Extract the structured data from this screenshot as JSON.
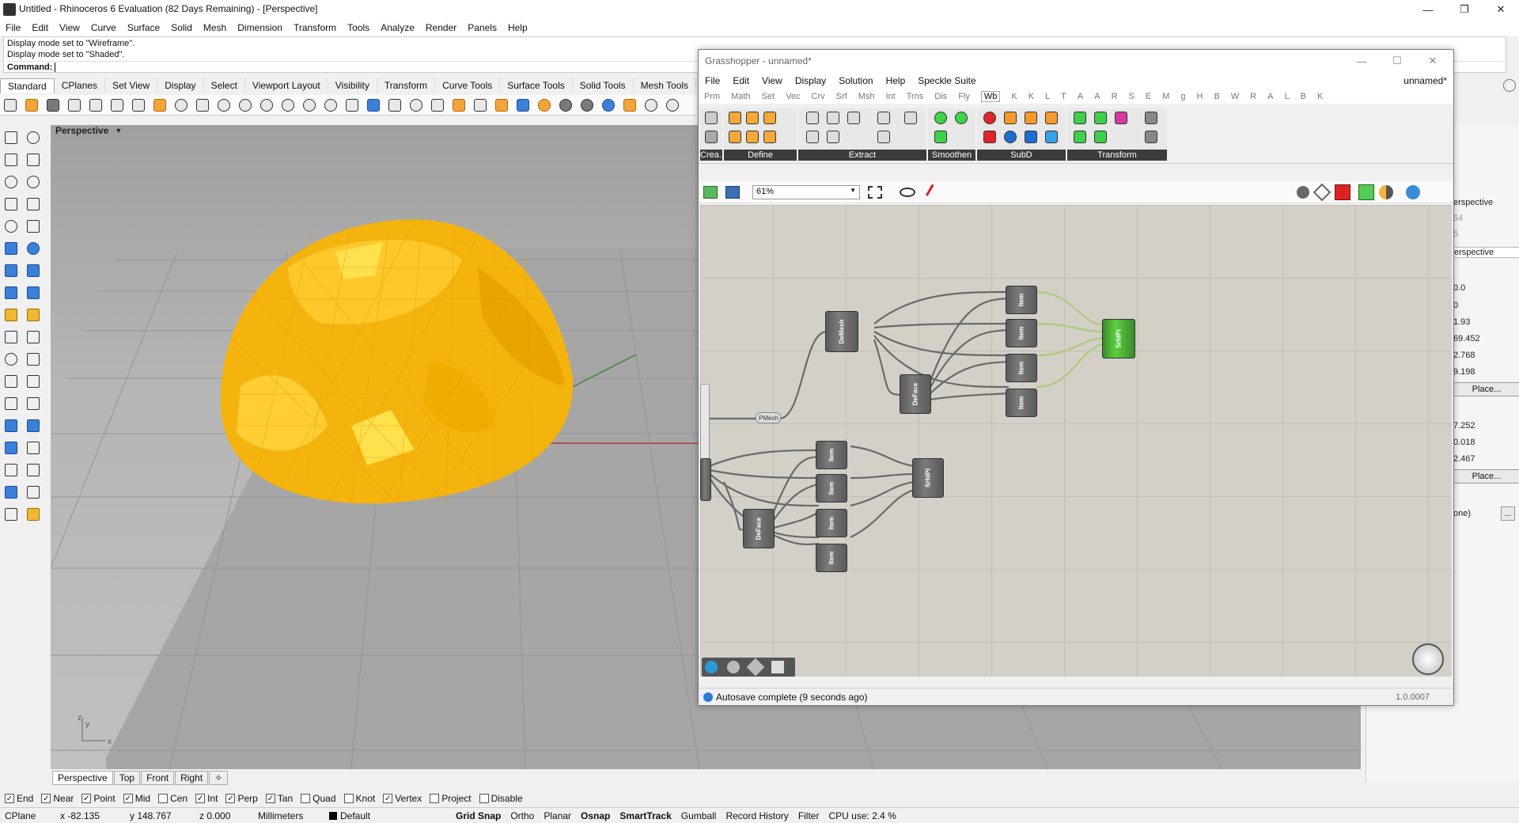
{
  "app": {
    "title": "Untitled - Rhinoceros 6 Evaluation (82 Days Remaining) - [Perspective]"
  },
  "menu": [
    "File",
    "Edit",
    "View",
    "Curve",
    "Surface",
    "Solid",
    "Mesh",
    "Dimension",
    "Transform",
    "Tools",
    "Analyze",
    "Render",
    "Panels",
    "Help"
  ],
  "command": {
    "history": [
      "Display mode set to \"Wireframe\".",
      "Display mode set to \"Shaded\"."
    ],
    "prompt": "Command:"
  },
  "toolbar_tabs": [
    "Standard",
    "CPlanes",
    "Set View",
    "Display",
    "Select",
    "Viewport Layout",
    "Visibility",
    "Transform",
    "Curve Tools",
    "Surface Tools",
    "Solid Tools",
    "Mesh Tools"
  ],
  "viewport": {
    "label": "Perspective",
    "tabs": [
      "Perspective",
      "Top",
      "Front",
      "Right"
    ],
    "colors": {
      "mesh": "#f6b50e",
      "background": "#a9a9a9",
      "grid": "#8f8f8f"
    }
  },
  "osnaps": [
    {
      "label": "End",
      "checked": true
    },
    {
      "label": "Near",
      "checked": true
    },
    {
      "label": "Point",
      "checked": true
    },
    {
      "label": "Mid",
      "checked": true
    },
    {
      "label": "Cen",
      "checked": false
    },
    {
      "label": "Int",
      "checked": true
    },
    {
      "label": "Perp",
      "checked": true
    },
    {
      "label": "Tan",
      "checked": true
    },
    {
      "label": "Quad",
      "checked": false
    },
    {
      "label": "Knot",
      "checked": false
    },
    {
      "label": "Vertex",
      "checked": true
    },
    {
      "label": "Project",
      "checked": false
    },
    {
      "label": "Disable",
      "checked": false
    }
  ],
  "statusbar": {
    "cplane": "CPlane",
    "x": "x -82.135",
    "y": "y 148.767",
    "z": "z 0.000",
    "units": "Millimeters",
    "layer": "Default",
    "toggles": [
      "Grid Snap",
      "Ortho",
      "Planar",
      "Osnap",
      "SmartTrack",
      "Gumball",
      "Record History",
      "Filter"
    ],
    "cpu": "CPU use: 2.4 %"
  },
  "right_panel": {
    "values": [
      "erspective",
      "54",
      "5",
      "erspective",
      "0.0",
      "0",
      "1.93",
      "69.452",
      "2.768",
      "9.198",
      "7.252",
      "0.018",
      "2.467",
      "one)"
    ],
    "place_label": "Place...",
    "more_label": "..."
  },
  "grasshopper": {
    "title": "Grasshopper - unnamed*",
    "doc_name": "unnamed*",
    "menu": [
      "File",
      "Edit",
      "View",
      "Display",
      "Solution",
      "Help",
      "Speckle Suite"
    ],
    "tabs": [
      "Prm",
      "Math",
      "Set",
      "Vec",
      "Crv",
      "Srf",
      "Msh",
      "Int",
      "Trns",
      "Dis",
      "Fly",
      "Wb",
      "K",
      "K",
      "L",
      "T",
      "A",
      "A",
      "R",
      "S",
      "E",
      "M",
      "g",
      "H",
      "B",
      "W",
      "R",
      "A",
      "L",
      "B",
      "K"
    ],
    "active_tab": "Wb",
    "ribbon_groups": [
      "Crea...",
      "Define",
      "Extract",
      "Smoothen",
      "SubD",
      "Transform"
    ],
    "zoom": "61%",
    "components": [
      "DeMesh",
      "DeFace",
      "Item",
      "Item",
      "Item",
      "Item",
      "SrfdPt",
      "DeFace",
      "Item",
      "Item",
      "Item",
      "Item",
      "SrfdPt",
      "PMesh"
    ],
    "status": "Autosave complete (9 seconds ago)",
    "version": "1.0.0007"
  }
}
